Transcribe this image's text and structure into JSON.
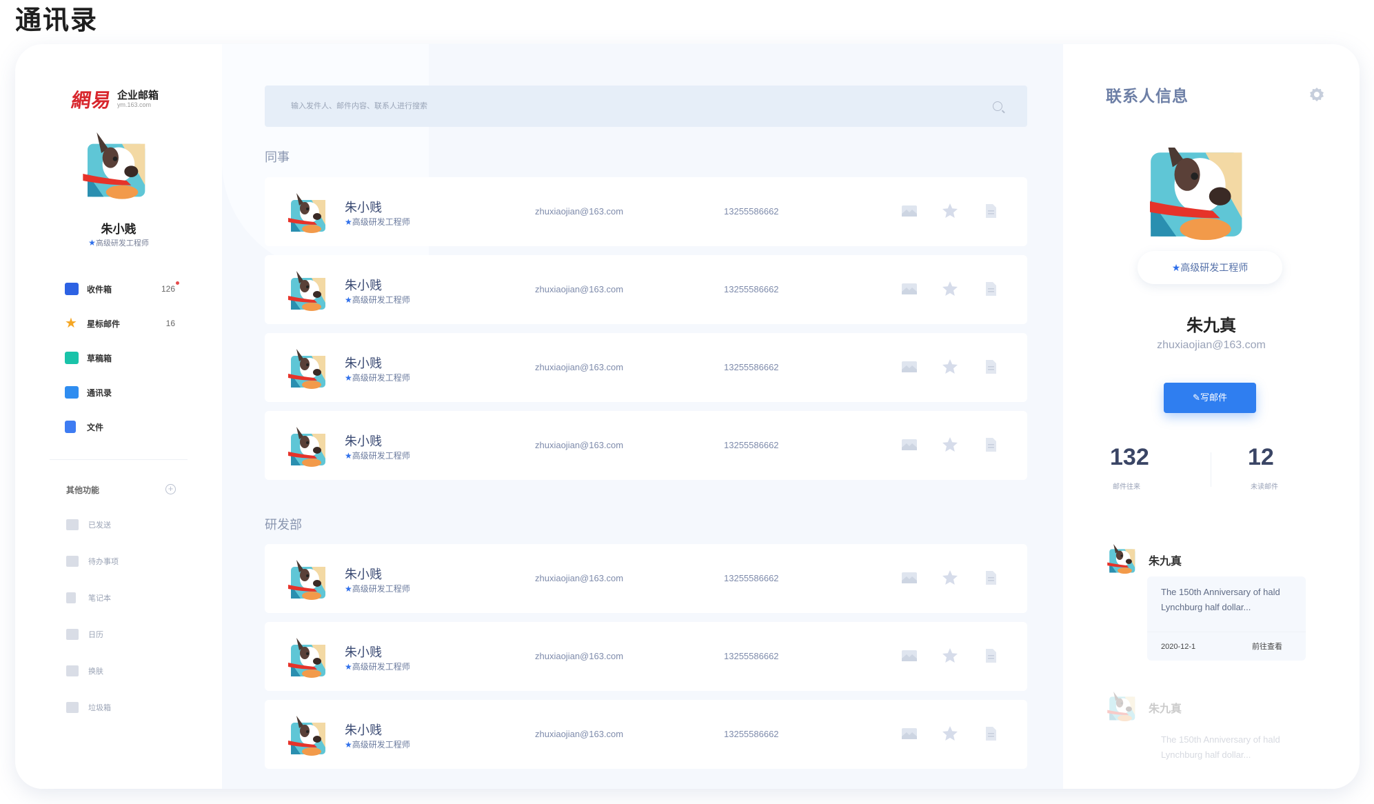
{
  "page_heading": "通讯录",
  "logo": {
    "mark": "網易",
    "title": "企业邮箱",
    "subtitle": "ym.163.com"
  },
  "profile": {
    "name": "朱小贱",
    "title": "高级研发工程师"
  },
  "nav": [
    {
      "label": "收件箱",
      "count": "126",
      "icon": "inbox-icon",
      "color": "#2d62e3"
    },
    {
      "label": "星标邮件",
      "count": "16",
      "icon": "star-icon",
      "color": "#f5a623"
    },
    {
      "label": "草稿箱",
      "count": "",
      "icon": "draft-icon",
      "color": "#19c3a9"
    },
    {
      "label": "通讯录",
      "count": "",
      "icon": "contacts-icon",
      "color": "#2f8df0"
    },
    {
      "label": "文件",
      "count": "",
      "icon": "file-icon",
      "color": "#3e7cf2"
    }
  ],
  "other": {
    "title": "其他功能",
    "items": [
      {
        "label": "已发送",
        "icon": "sent-icon"
      },
      {
        "label": "待办事项",
        "icon": "todo-icon"
      },
      {
        "label": "笔记本",
        "icon": "notebook-icon"
      },
      {
        "label": "日历",
        "icon": "calendar-icon"
      },
      {
        "label": "换肤",
        "icon": "skin-icon"
      },
      {
        "label": "垃圾箱",
        "icon": "trash-icon"
      }
    ]
  },
  "search": {
    "placeholder": "输入发件人、邮件内容、联系人进行搜索"
  },
  "groups": [
    {
      "title": "同事",
      "rows": [
        {
          "name": "朱小贱",
          "title": "高级研发工程师",
          "email": "zhuxiaojian@163.com",
          "phone": "13255586662"
        },
        {
          "name": "朱小贱",
          "title": "高级研发工程师",
          "email": "zhuxiaojian@163.com",
          "phone": "13255586662"
        },
        {
          "name": "朱小贱",
          "title": "高级研发工程师",
          "email": "zhuxiaojian@163.com",
          "phone": "13255586662"
        },
        {
          "name": "朱小贱",
          "title": "高级研发工程师",
          "email": "zhuxiaojian@163.com",
          "phone": "13255586662"
        }
      ]
    },
    {
      "title": "研发部",
      "rows": [
        {
          "name": "朱小贱",
          "title": "高级研发工程师",
          "email": "zhuxiaojian@163.com",
          "phone": "13255586662"
        },
        {
          "name": "朱小贱",
          "title": "高级研发工程师",
          "email": "zhuxiaojian@163.com",
          "phone": "13255586662"
        },
        {
          "name": "朱小贱",
          "title": "高级研发工程师",
          "email": "zhuxiaojian@163.com",
          "phone": "13255586662"
        }
      ]
    }
  ],
  "panel": {
    "title": "联系人信息",
    "contact_title": "高级研发工程师",
    "name": "朱九真",
    "email": "zhuxiaojian@163.com",
    "compose_label": "写邮件",
    "stats": [
      {
        "value": "132",
        "label": "邮件往来"
      },
      {
        "value": "12",
        "label": "未读邮件"
      }
    ],
    "messages": [
      {
        "name": "朱九真",
        "text": "The 150th Anniversary of hald Lynchburg half dollar...",
        "date": "2020-12-1",
        "link": "前往查看"
      },
      {
        "name": "朱九真",
        "text": "The 150th Anniversary of hald Lynchburg half dollar..."
      }
    ]
  },
  "colors": {
    "accent": "#2f7ef0",
    "star_blue": "#2f6fea",
    "star_orange": "#f5a623",
    "bg_main": "#f5f8fd"
  }
}
